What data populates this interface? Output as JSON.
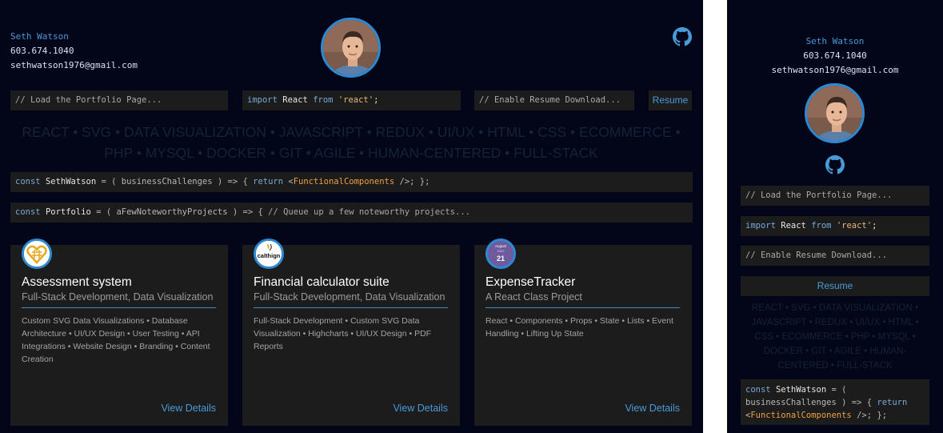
{
  "profile": {
    "name": "Seth Watson",
    "phone": "603.674.1040",
    "email": "sethwatson1976@gmail.com"
  },
  "toolbar": {
    "load_portfolio": "// Load the Portfolio Page...",
    "import_parts": [
      "import",
      "React",
      "from",
      "'react'",
      ";"
    ],
    "enable_resume": "// Enable Resume Download...",
    "resume_label": "Resume"
  },
  "skills_text": "REACT • SVG • DATA VISUALIZATION • JAVASCRIPT • REDUX • UI/UX • HTML • CSS • ECOMMERCE • PHP • MYSQL • DOCKER • GIT • AGILE • HUMAN-CENTERED • FULL-STACK",
  "code_lines": {
    "seth_watson": {
      "kw1": "const",
      "name": "SethWatson",
      "mid": "= ( businessChallenges ) => {",
      "kw2": "return",
      "jsx_open": "<",
      "jsx_name": "FunctionalComponents",
      "jsx_close": " />; };"
    },
    "portfolio": {
      "kw1": "const",
      "name": "Portfolio",
      "mid": "= ( aFewNoteworthyProjects ) => {",
      "comment": "// Queue up a few noteworthy projects..."
    }
  },
  "projects": [
    {
      "title": "Assessment system",
      "subtitle": "Full-Stack Development, Data Visualization",
      "description": "Custom SVG Data Visualizations • Database Architecture • UI/UX Design • User Testing • API Integrations • Website Design • Branding • Content Creation",
      "cta": "View Details",
      "logo": "gold-heart-knot-icon"
    },
    {
      "title": "Financial calculator suite",
      "subtitle": "Full-Stack Development, Data Visualization",
      "description": "Full-Stack Development • Custom SVG Data Visualization • Highcharts • UI/UX Design • PDF Reports",
      "cta": "View Details",
      "logo_text": "calthign",
      "logo": "calthign-logo-icon"
    },
    {
      "title": "ExpenseTracker",
      "subtitle": "A React Class Project",
      "description": "React • Components • Props • State • Lists • Event Handling • Lifting Up State",
      "cta": "View Details",
      "calendar": {
        "month": "August",
        "year": "2022",
        "day": "21"
      },
      "logo": "calendar-date-icon"
    }
  ],
  "colors": {
    "background": "#030518",
    "panel": "#1c1c1c",
    "accent": "#2c8ad4",
    "link": "#4a9ad8",
    "skills_text": "#152339",
    "jsx": "#f0a040"
  },
  "icons": {
    "github": "github-icon",
    "avatar": "profile-photo"
  }
}
